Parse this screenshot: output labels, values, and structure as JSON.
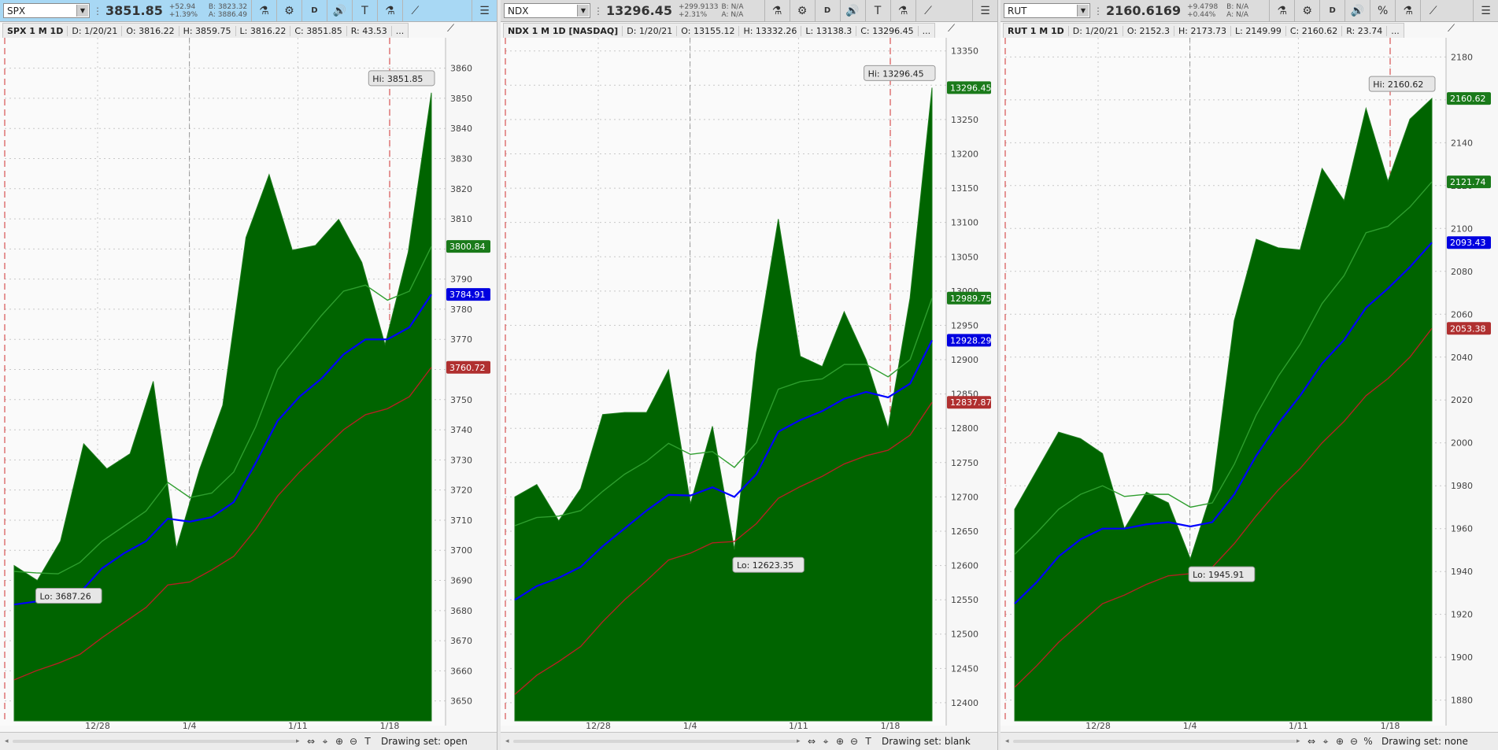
{
  "colors": {
    "area": "#006400",
    "area_line": "#1a7a1a",
    "light_green": "#2e9e2e",
    "blue": "#0000ff",
    "red": "#b22222",
    "grid": "#c8c8c8",
    "tag_green": "#1a7a1a",
    "tag_blue": "#0000e0",
    "tag_red": "#b03030",
    "bubble_bg": "#e6e6e6"
  },
  "toolbar_icons": [
    "beaker-icon",
    "gear-icon",
    "d-button",
    "speaker-icon",
    "text-icon",
    "beaker-icon",
    "drawing-icon",
    "menu-icon"
  ],
  "panels": [
    {
      "symbol": "SPX",
      "price": "3851.85",
      "change": "+52.94",
      "change_pct": "+1.39%",
      "bid": "B: 3823.32",
      "ask": "A: 3886.49",
      "toolbar_buttons": [
        "⚗",
        "⚙",
        "D",
        "🔊",
        "T",
        "⚗",
        "⟋",
        "☰"
      ],
      "info": {
        "title": "SPX 1 M 1D",
        "date": "D: 1/20/21",
        "open": "O: 3816.22",
        "high": "H: 3859.75",
        "low": "L: 3816.22",
        "close": "C: 3851.85",
        "range": "R: 43.53",
        "more": "..."
      },
      "drawing_set": "Drawing set: open",
      "footer_icons": [
        "⇔",
        "⌖",
        "⊕",
        "⊖",
        "T"
      ],
      "chart_data": {
        "type": "area",
        "x_labels": [
          "12/28",
          "1/4",
          "1/11",
          "1/18"
        ],
        "ylim": [
          3646,
          3868
        ],
        "y_ticks": [
          3650,
          3660,
          3670,
          3680,
          3690,
          3700,
          3710,
          3720,
          3730,
          3740,
          3750,
          3760,
          3770,
          3780,
          3790,
          3800,
          3810,
          3820,
          3830,
          3840,
          3850,
          3860
        ],
        "close": [
          3694.92,
          3690.01,
          3703.06,
          3735.36,
          3727.04,
          3732.04,
          3756.07,
          3700.65,
          3726.86,
          3748.14,
          3803.79,
          3824.68,
          3799.61,
          3801.19,
          3809.84,
          3795.54,
          3768.25,
          3798.91,
          3851.85
        ],
        "sma_light": [
          3693.0,
          3692.5,
          3692.2,
          3696.0,
          3703.0,
          3708.0,
          3713.0,
          3722.5,
          3717.5,
          3719.0,
          3726.0,
          3741.0,
          3760.0,
          3769.0,
          3778.0,
          3786.0,
          3788.0,
          3783.0,
          3786.0,
          3800.84
        ],
        "ema_blue": [
          3682.0,
          3683.0,
          3684.0,
          3686.0,
          3694.0,
          3699.0,
          3703.0,
          3710.5,
          3709.5,
          3711.0,
          3716.0,
          3729.0,
          3743.0,
          3751.0,
          3757.0,
          3765.0,
          3770.0,
          3770.0,
          3774.0,
          3784.91
        ],
        "sma_red": [
          3657.0,
          3660.0,
          3662.5,
          3665.5,
          3671.0,
          3676.0,
          3681.0,
          3688.5,
          3689.5,
          3693.5,
          3698.0,
          3707.0,
          3718.0,
          3726.0,
          3733.0,
          3740.0,
          3745.0,
          3747.0,
          3751.0,
          3760.72
        ],
        "hi_label": "Hi: 3851.85",
        "lo_label": "Lo: 3687.26",
        "tags": [
          "3800.84",
          "3784.91",
          "3760.72"
        ]
      }
    },
    {
      "symbol": "NDX",
      "price": "13296.45",
      "change": "+299.9133",
      "change_pct": "+2.31%",
      "bid": "B: N/A",
      "ask": "A: N/A",
      "toolbar_buttons": [
        "⚗",
        "⚙",
        "D",
        "🔊",
        "T",
        "⚗",
        "⟋",
        "☰"
      ],
      "info": {
        "title": "NDX 1 M 1D [NASDAQ]",
        "date": "D: 1/20/21",
        "open": "O: 13155.12",
        "high": "H: 13332.26",
        "low": "L: 13138.3",
        "close": "C: 13296.45",
        "range": "",
        "more": "..."
      },
      "drawing_set": "Drawing set: blank",
      "footer_icons": [
        "⇔",
        "⌖",
        "⊕",
        "⊖",
        "T"
      ],
      "chart_data": {
        "type": "area",
        "x_labels": [
          "12/28",
          "1/4",
          "1/11",
          "1/18"
        ],
        "ylim": [
          12385,
          13360
        ],
        "y_ticks": [
          12400,
          12450,
          12500,
          12550,
          12600,
          12650,
          12700,
          12750,
          12800,
          12850,
          12900,
          12950,
          13000,
          13050,
          13100,
          13150,
          13200,
          13250,
          13300,
          13350
        ],
        "close": [
          12700,
          12718,
          12665,
          12712,
          12820,
          12823,
          12823,
          12885,
          12690,
          12803,
          12623.35,
          12910,
          13105,
          12905,
          12890,
          12970,
          12900,
          12800,
          12990,
          13296.45
        ],
        "sma_light": [
          12658,
          12670,
          12672,
          12680,
          12708,
          12733,
          12752,
          12778,
          12762,
          12766,
          12743,
          12779,
          12857,
          12868,
          12872,
          12893,
          12893,
          12875,
          12900,
          12989.75
        ],
        "ema_blue": [
          12550,
          12570,
          12582,
          12598,
          12628,
          12654,
          12680,
          12703,
          12702,
          12714,
          12700,
          12733,
          12795,
          12812,
          12825,
          12843,
          12853,
          12845,
          12865,
          12928.29
        ],
        "sma_red": [
          12412,
          12440,
          12460,
          12482,
          12518,
          12550,
          12578,
          12608,
          12618,
          12633,
          12635,
          12661,
          12698,
          12715,
          12730,
          12748,
          12760,
          12768,
          12790,
          12837.87
        ],
        "hi_label": "Hi: 13296.45",
        "lo_label": "Lo: 12623.35",
        "tags": [
          "13296.45",
          "12989.75",
          "12928.29",
          "12837.87"
        ]
      }
    },
    {
      "symbol": "RUT",
      "price": "2160.6169",
      "change": "+9.4798",
      "change_pct": "+0.44%",
      "bid": "B: N/A",
      "ask": "A: N/A",
      "toolbar_buttons": [
        "⚗",
        "⚙",
        "D",
        "🔊",
        "%",
        "⚗",
        "⟋",
        "☰"
      ],
      "info": {
        "title": "RUT 1 M 1D",
        "date": "D: 1/20/21",
        "open": "O: 2152.3",
        "high": "H: 2173.73",
        "low": "L: 2149.99",
        "close": "C: 2160.62",
        "range": "R: 23.74",
        "more": "..."
      },
      "drawing_set": "Drawing set: none",
      "footer_icons": [
        "⇔",
        "⌖",
        "⊕",
        "⊖",
        "%"
      ],
      "chart_data": {
        "type": "area",
        "x_labels": [
          "12/28",
          "1/4",
          "1/11",
          "1/18"
        ],
        "ylim": [
          1874,
          2186
        ],
        "y_ticks": [
          1880,
          1900,
          1920,
          1940,
          1960,
          1980,
          2000,
          2020,
          2040,
          2060,
          2080,
          2100,
          2120,
          2140,
          2160,
          2180
        ],
        "close": [
          1969,
          1987,
          2005,
          2002,
          1995,
          1960,
          1977,
          1972,
          1945.91,
          1978,
          2057,
          2095,
          2091,
          2090,
          2128,
          2113,
          2156,
          2122,
          2151,
          2160.62
        ],
        "sma_light": [
          1948,
          1958,
          1969,
          1976,
          1980,
          1975,
          1976,
          1976,
          1970,
          1972,
          1990,
          2013,
          2031,
          2046,
          2065,
          2078,
          2098,
          2101,
          2110,
          2121.74
        ],
        "ema_blue": [
          1925,
          1935,
          1947,
          1955,
          1960,
          1960,
          1962,
          1963,
          1961,
          1963,
          1976,
          1994,
          2009,
          2022,
          2037,
          2048,
          2063,
          2072,
          2082,
          2093.43
        ],
        "sma_red": [
          1886,
          1896,
          1907,
          1916,
          1925,
          1929,
          1934,
          1938,
          1939,
          1942,
          1953,
          1966,
          1978,
          1988,
          2000,
          2010,
          2022,
          2030,
          2040,
          2053.38
        ],
        "hi_label": "Hi: 2160.62",
        "lo_label": "Lo: 1945.91",
        "tags": [
          "2160.62",
          "2121.74",
          "2093.43",
          "2053.38"
        ]
      }
    }
  ]
}
